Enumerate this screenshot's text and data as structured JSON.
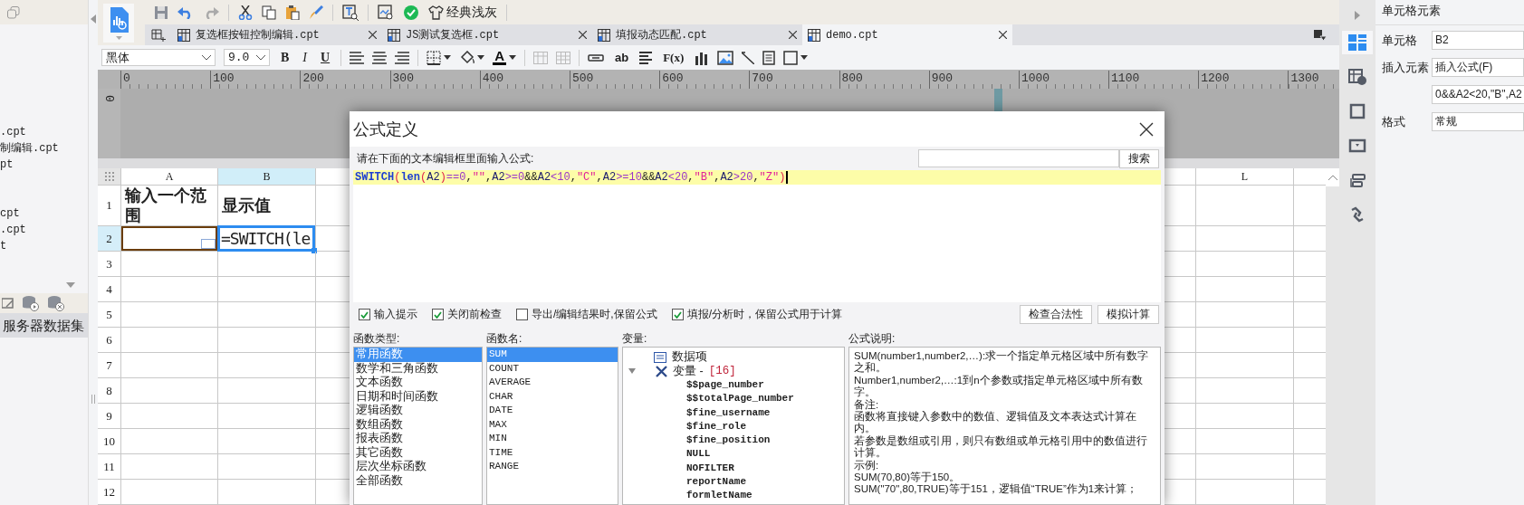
{
  "left_panel": {
    "file_groups": [
      [
        ".cpt",
        "制编辑.cpt",
        "pt"
      ],
      [
        "cpt",
        ".cpt",
        "t"
      ]
    ],
    "datasets": [
      {
        "label": "服务器数据集",
        "selected": true
      }
    ]
  },
  "toolbar": {
    "theme_button": "经典浅灰"
  },
  "tabs": [
    {
      "label": "复选框按钮控制编辑.cpt",
      "selected": false
    },
    {
      "label": "JS测试复选框.cpt",
      "selected": false
    },
    {
      "label": "填报动态匹配.cpt",
      "selected": false
    },
    {
      "label": "demo.cpt",
      "selected": true
    }
  ],
  "format_toolbar": {
    "font": "黑体",
    "size": "9.0",
    "style_buttons": [
      "B",
      "I",
      "U"
    ],
    "font_color_button": "A",
    "text_button": "ab",
    "formula_button": "F(x)"
  },
  "ruler": {
    "marks": [
      "0",
      "100",
      "200",
      "300",
      "400",
      "500",
      "600",
      "700",
      "800",
      "900",
      "1000",
      "1100",
      "1200",
      "1300"
    ],
    "vertical_marks": [
      "0"
    ]
  },
  "sheet": {
    "columns": [
      {
        "label": "A",
        "selected": false
      },
      {
        "label": "B",
        "selected": true
      },
      {
        "label": "L",
        "selected": false
      }
    ],
    "rows": [
      {
        "label": "1",
        "selected": false,
        "cells": [
          {
            "kind": "plain",
            "text": "输入一个范围"
          },
          {
            "kind": "plain",
            "text": "显示值"
          }
        ]
      },
      {
        "label": "2",
        "selected": true,
        "cells": [
          {
            "kind": "reference"
          },
          {
            "kind": "editing",
            "text": "=SWITCH(le"
          }
        ]
      },
      {
        "label": "3",
        "selected": false
      },
      {
        "label": "4",
        "selected": false
      },
      {
        "label": "5",
        "selected": false
      },
      {
        "label": "6",
        "selected": false
      },
      {
        "label": "7",
        "selected": false
      },
      {
        "label": "8",
        "selected": false
      },
      {
        "label": "9",
        "selected": false
      },
      {
        "label": "10",
        "selected": false
      },
      {
        "label": "11",
        "selected": false
      },
      {
        "label": "12",
        "selected": false
      }
    ]
  },
  "dialog": {
    "title": "公式定义",
    "instruction": "请在下面的文本编辑框里面输入公式:",
    "search_button": "搜索",
    "formula": [
      {
        "kind": "func",
        "text": "SWITCH"
      },
      {
        "kind": "paren",
        "text": "("
      },
      {
        "kind": "func",
        "text": "len"
      },
      {
        "kind": "paren",
        "text": "("
      },
      {
        "kind": "ref",
        "text": "A2"
      },
      {
        "kind": "paren",
        "text": ")"
      },
      {
        "kind": "op",
        "text": "==0"
      },
      {
        "kind": "punct",
        "text": ","
      },
      {
        "kind": "str",
        "text": "\"\""
      },
      {
        "kind": "punct",
        "text": ","
      },
      {
        "kind": "ref",
        "text": "A2"
      },
      {
        "kind": "op",
        "text": ">=0"
      },
      {
        "kind": "punct",
        "text": "&&"
      },
      {
        "kind": "ref",
        "text": "A2"
      },
      {
        "kind": "op",
        "text": "<10"
      },
      {
        "kind": "punct",
        "text": ","
      },
      {
        "kind": "str",
        "text": "\"C\""
      },
      {
        "kind": "punct",
        "text": ","
      },
      {
        "kind": "ref",
        "text": "A2"
      },
      {
        "kind": "op",
        "text": ">=10"
      },
      {
        "kind": "punct",
        "text": "&&"
      },
      {
        "kind": "ref",
        "text": "A2"
      },
      {
        "kind": "op",
        "text": "<20"
      },
      {
        "kind": "punct",
        "text": ","
      },
      {
        "kind": "str",
        "text": "\"B\""
      },
      {
        "kind": "punct",
        "text": ","
      },
      {
        "kind": "ref",
        "text": "A2"
      },
      {
        "kind": "op",
        "text": ">20"
      },
      {
        "kind": "punct",
        "text": ","
      },
      {
        "kind": "str",
        "text": "\"Z\""
      },
      {
        "kind": "paren",
        "text": ")"
      }
    ],
    "options": [
      {
        "label": "输入提示",
        "checked": true
      },
      {
        "label": "关闭前检查",
        "checked": true
      },
      {
        "label": "导出/编辑结果时,保留公式",
        "checked": false
      },
      {
        "label": "填报/分析时，保留公式用于计算",
        "checked": true
      }
    ],
    "buttons": [
      "检查合法性",
      "模拟计算"
    ],
    "function_types": {
      "header": "函数类型:",
      "items": [
        {
          "label": "常用函数",
          "selected": true
        },
        {
          "label": "数学和三角函数",
          "selected": false
        },
        {
          "label": "文本函数",
          "selected": false
        },
        {
          "label": "日期和时间函数",
          "selected": false
        },
        {
          "label": "逻辑函数",
          "selected": false
        },
        {
          "label": "数组函数",
          "selected": false
        },
        {
          "label": "报表函数",
          "selected": false
        },
        {
          "label": "其它函数",
          "selected": false
        },
        {
          "label": "层次坐标函数",
          "selected": false
        },
        {
          "label": "全部函数",
          "selected": false
        }
      ]
    },
    "function_names": {
      "header": "函数名:",
      "items": [
        {
          "label": "SUM",
          "selected": true
        },
        {
          "label": "COUNT",
          "selected": false
        },
        {
          "label": "AVERAGE",
          "selected": false
        },
        {
          "label": "CHAR",
          "selected": false
        },
        {
          "label": "DATE",
          "selected": false
        },
        {
          "label": "MAX",
          "selected": false
        },
        {
          "label": "MIN",
          "selected": false
        },
        {
          "label": "TIME",
          "selected": false
        },
        {
          "label": "RANGE",
          "selected": false
        }
      ]
    },
    "variables": {
      "header": "变量:",
      "items": [
        {
          "kind": "data",
          "label": "数据项"
        },
        {
          "kind": "group",
          "label": "变量 -",
          "count": "[16]",
          "expanded": true,
          "children": [
            {
              "label": "$$page_number"
            },
            {
              "label": "$$totalPage_number"
            },
            {
              "label": "$fine_username"
            },
            {
              "label": "$fine_role"
            },
            {
              "label": "$fine_position"
            },
            {
              "label": "NULL"
            },
            {
              "label": "NOFILTER"
            },
            {
              "label": "reportName"
            },
            {
              "label": "formletName"
            }
          ]
        }
      ]
    },
    "description": {
      "header": "公式说明:",
      "paragraphs": [
        "SUM(number1,number2,…):求一个指定单元格区域中所有数字之和。",
        "Number1,number2,…:1到n个参数或指定单元格区域中所有数字。",
        "备注:",
        "函数将直接键入参数中的数值、逻辑值及文本表达式计算在内。",
        "若参数是数组或引用，则只有数组或单元格引用中的数值进行计算。",
        "示例:",
        "SUM(70,80)等于150。",
        "SUM(\"70\",80,TRUE)等于151，逻辑值“TRUE”作为1来计算；"
      ]
    }
  },
  "right_panel": {
    "title": "单元格元素",
    "tabs": [
      {
        "selected": true
      },
      {
        "selected": false
      },
      {
        "selected": false
      },
      {
        "selected": false
      },
      {
        "selected": false
      },
      {
        "selected": false
      }
    ],
    "fields": [
      {
        "label": "单元格",
        "value": "B2"
      },
      {
        "label": "插入元素",
        "value": "插入公式(F)"
      },
      {
        "value": "0&&A2<20,\"B\",A2"
      },
      {
        "label": "格式",
        "value": "常规"
      }
    ]
  }
}
